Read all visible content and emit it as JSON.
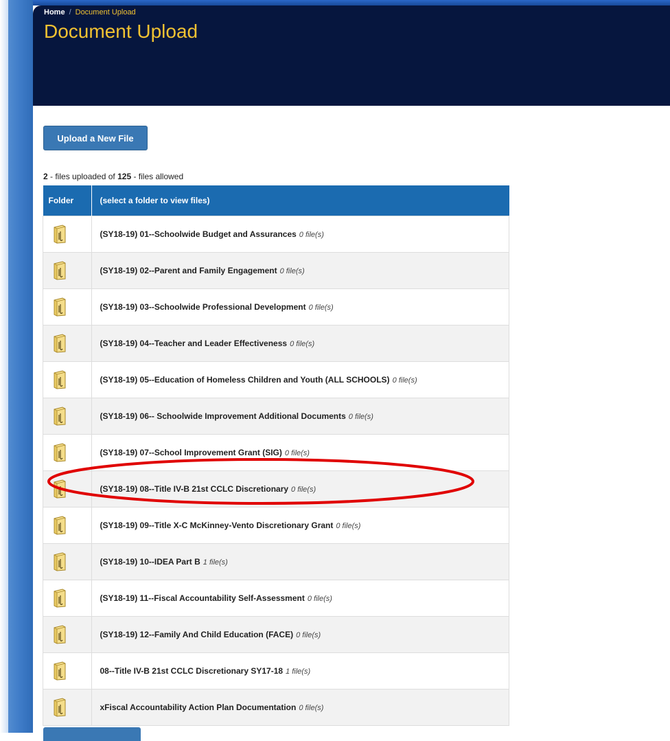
{
  "breadcrumb": {
    "home": "Home",
    "separator": "/",
    "current": "Document Upload"
  },
  "page": {
    "title": "Document Upload"
  },
  "upload_button_label": "Upload a New File",
  "summary": {
    "uploaded": "2",
    "uploaded_text": " - files uploaded of ",
    "allowed": "125",
    "allowed_text": " - files allowed"
  },
  "table": {
    "headers": [
      "Folder",
      "(select a folder to view files)"
    ],
    "rows": [
      {
        "name": "(SY18-19) 01--Schoolwide Budget and Assurances",
        "count": "0 file(s)"
      },
      {
        "name": "(SY18-19) 02--Parent and Family Engagement",
        "count": "0 file(s)"
      },
      {
        "name": "(SY18-19) 03--Schoolwide Professional Development",
        "count": "0 file(s)"
      },
      {
        "name": "(SY18-19) 04--Teacher and Leader Effectiveness",
        "count": "0 file(s)"
      },
      {
        "name": "(SY18-19) 05--Education of Homeless Children and Youth (ALL SCHOOLS)",
        "count": "0 file(s)"
      },
      {
        "name": "(SY18-19) 06-- Schoolwide Improvement Additional Documents",
        "count": "0 file(s)"
      },
      {
        "name": "(SY18-19) 07--School Improvement Grant (SIG)",
        "count": "0 file(s)"
      },
      {
        "name": "(SY18-19) 08--Title IV-B 21st CCLC Discretionary",
        "count": "0 file(s)"
      },
      {
        "name": "(SY18-19) 09--Title X-C McKinney-Vento Discretionary Grant",
        "count": "0 file(s)"
      },
      {
        "name": "(SY18-19) 10--IDEA Part B",
        "count": "1 file(s)"
      },
      {
        "name": "(SY18-19) 11--Fiscal Accountability Self-Assessment",
        "count": "0 file(s)"
      },
      {
        "name": "(SY18-19) 12--Family And Child Education (FACE)",
        "count": "0 file(s)"
      },
      {
        "name": "08--Title IV-B 21st CCLC Discretionary SY17-18",
        "count": "1 file(s)"
      },
      {
        "name": "xFiscal Accountability Action Plan Documentation",
        "count": "0 file(s)"
      }
    ]
  },
  "icons": {
    "folder": "folder-zipper-icon"
  },
  "colors": {
    "header_bg": "#06163e",
    "title": "#f1c232",
    "table_header": "#1b6bb0",
    "button": "#3a78b4",
    "annotation": "#e00000"
  }
}
